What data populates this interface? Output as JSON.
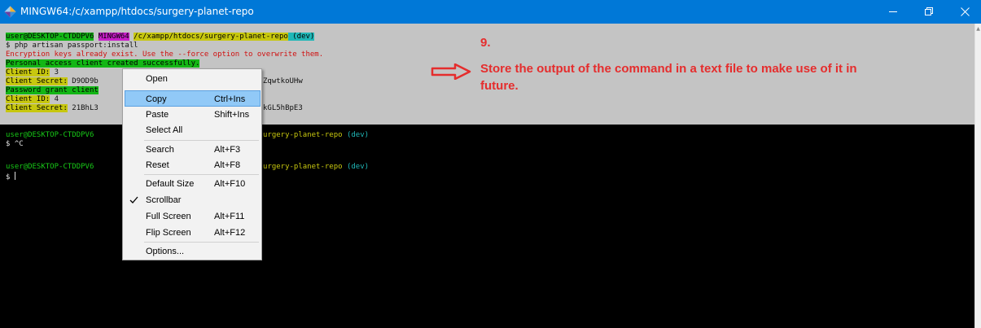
{
  "window": {
    "title": "MINGW64:/c/xampp/htdocs/surgery-planet-repo",
    "app_icon": "mingw-diamond-icon",
    "controls": [
      "minimize-icon",
      "maximize-icon",
      "close-icon"
    ]
  },
  "terminal": {
    "prompt1": {
      "user": "user@DESKTOP-CTDDPV6",
      "sep1": " ",
      "env": "MINGW64",
      "sep2": " ",
      "path": "/c/xampp/htdocs/surgery-planet-repo",
      "branch": " (dev)"
    },
    "command": "$ php artisan passport:install",
    "warning": "Encryption keys already exist. Use the --force option to overwrite them.",
    "personal_access": "Personal access client created successfully.",
    "client_id_label_1": "Client ID:",
    "client_id_value_1": " 3",
    "client_secret_label_1": "Client Secret:",
    "client_secret_value_1": " D9OD9b",
    "client_secret_tail_1": "ZqwtkoUHw",
    "password_grant": "Password grant client",
    "client_id_label_2": "Client ID:",
    "client_id_value_2": " 4",
    "client_secret_label_2": "Client Secret:",
    "client_secret_value_2": " 21BhL3",
    "client_secret_tail_2": "kGL5hBpE3",
    "prompt2": {
      "user": "user@DESKTOP-CTDDPV6",
      "path": "urgery-planet-repo",
      "branch": " (dev)"
    },
    "ctrl_c": "$ ^C",
    "prompt3": {
      "user": "user@DESKTOP-CTDDPV6",
      "path": "urgery-planet-repo",
      "branch": " (dev)"
    },
    "final_prompt": "$ "
  },
  "annotation": {
    "step": "9.",
    "line1": "Store the output of the command in a text file to make use of it in",
    "line2": "future."
  },
  "context_menu": {
    "items": [
      {
        "label": "Open",
        "shortcut": ""
      },
      {
        "label": "Copy",
        "shortcut": "Ctrl+Ins"
      },
      {
        "label": "Paste",
        "shortcut": "Shift+Ins"
      },
      {
        "label": "Select All",
        "shortcut": ""
      },
      {
        "label": "Search",
        "shortcut": "Alt+F3"
      },
      {
        "label": "Reset",
        "shortcut": "Alt+F8"
      },
      {
        "label": "Default Size",
        "shortcut": "Alt+F10"
      },
      {
        "label": "Scrollbar",
        "shortcut": ""
      },
      {
        "label": "Full Screen",
        "shortcut": "Alt+F11"
      },
      {
        "label": "Flip Screen",
        "shortcut": "Alt+F12"
      },
      {
        "label": "Options...",
        "shortcut": ""
      }
    ],
    "highlighted": "Copy",
    "checked": "Scrollbar"
  },
  "colors": {
    "titlebar": "#0078d7",
    "selection": "#c4c4c4",
    "menu_highlight": "#91c9f7",
    "annotation": "#e52d2d"
  }
}
